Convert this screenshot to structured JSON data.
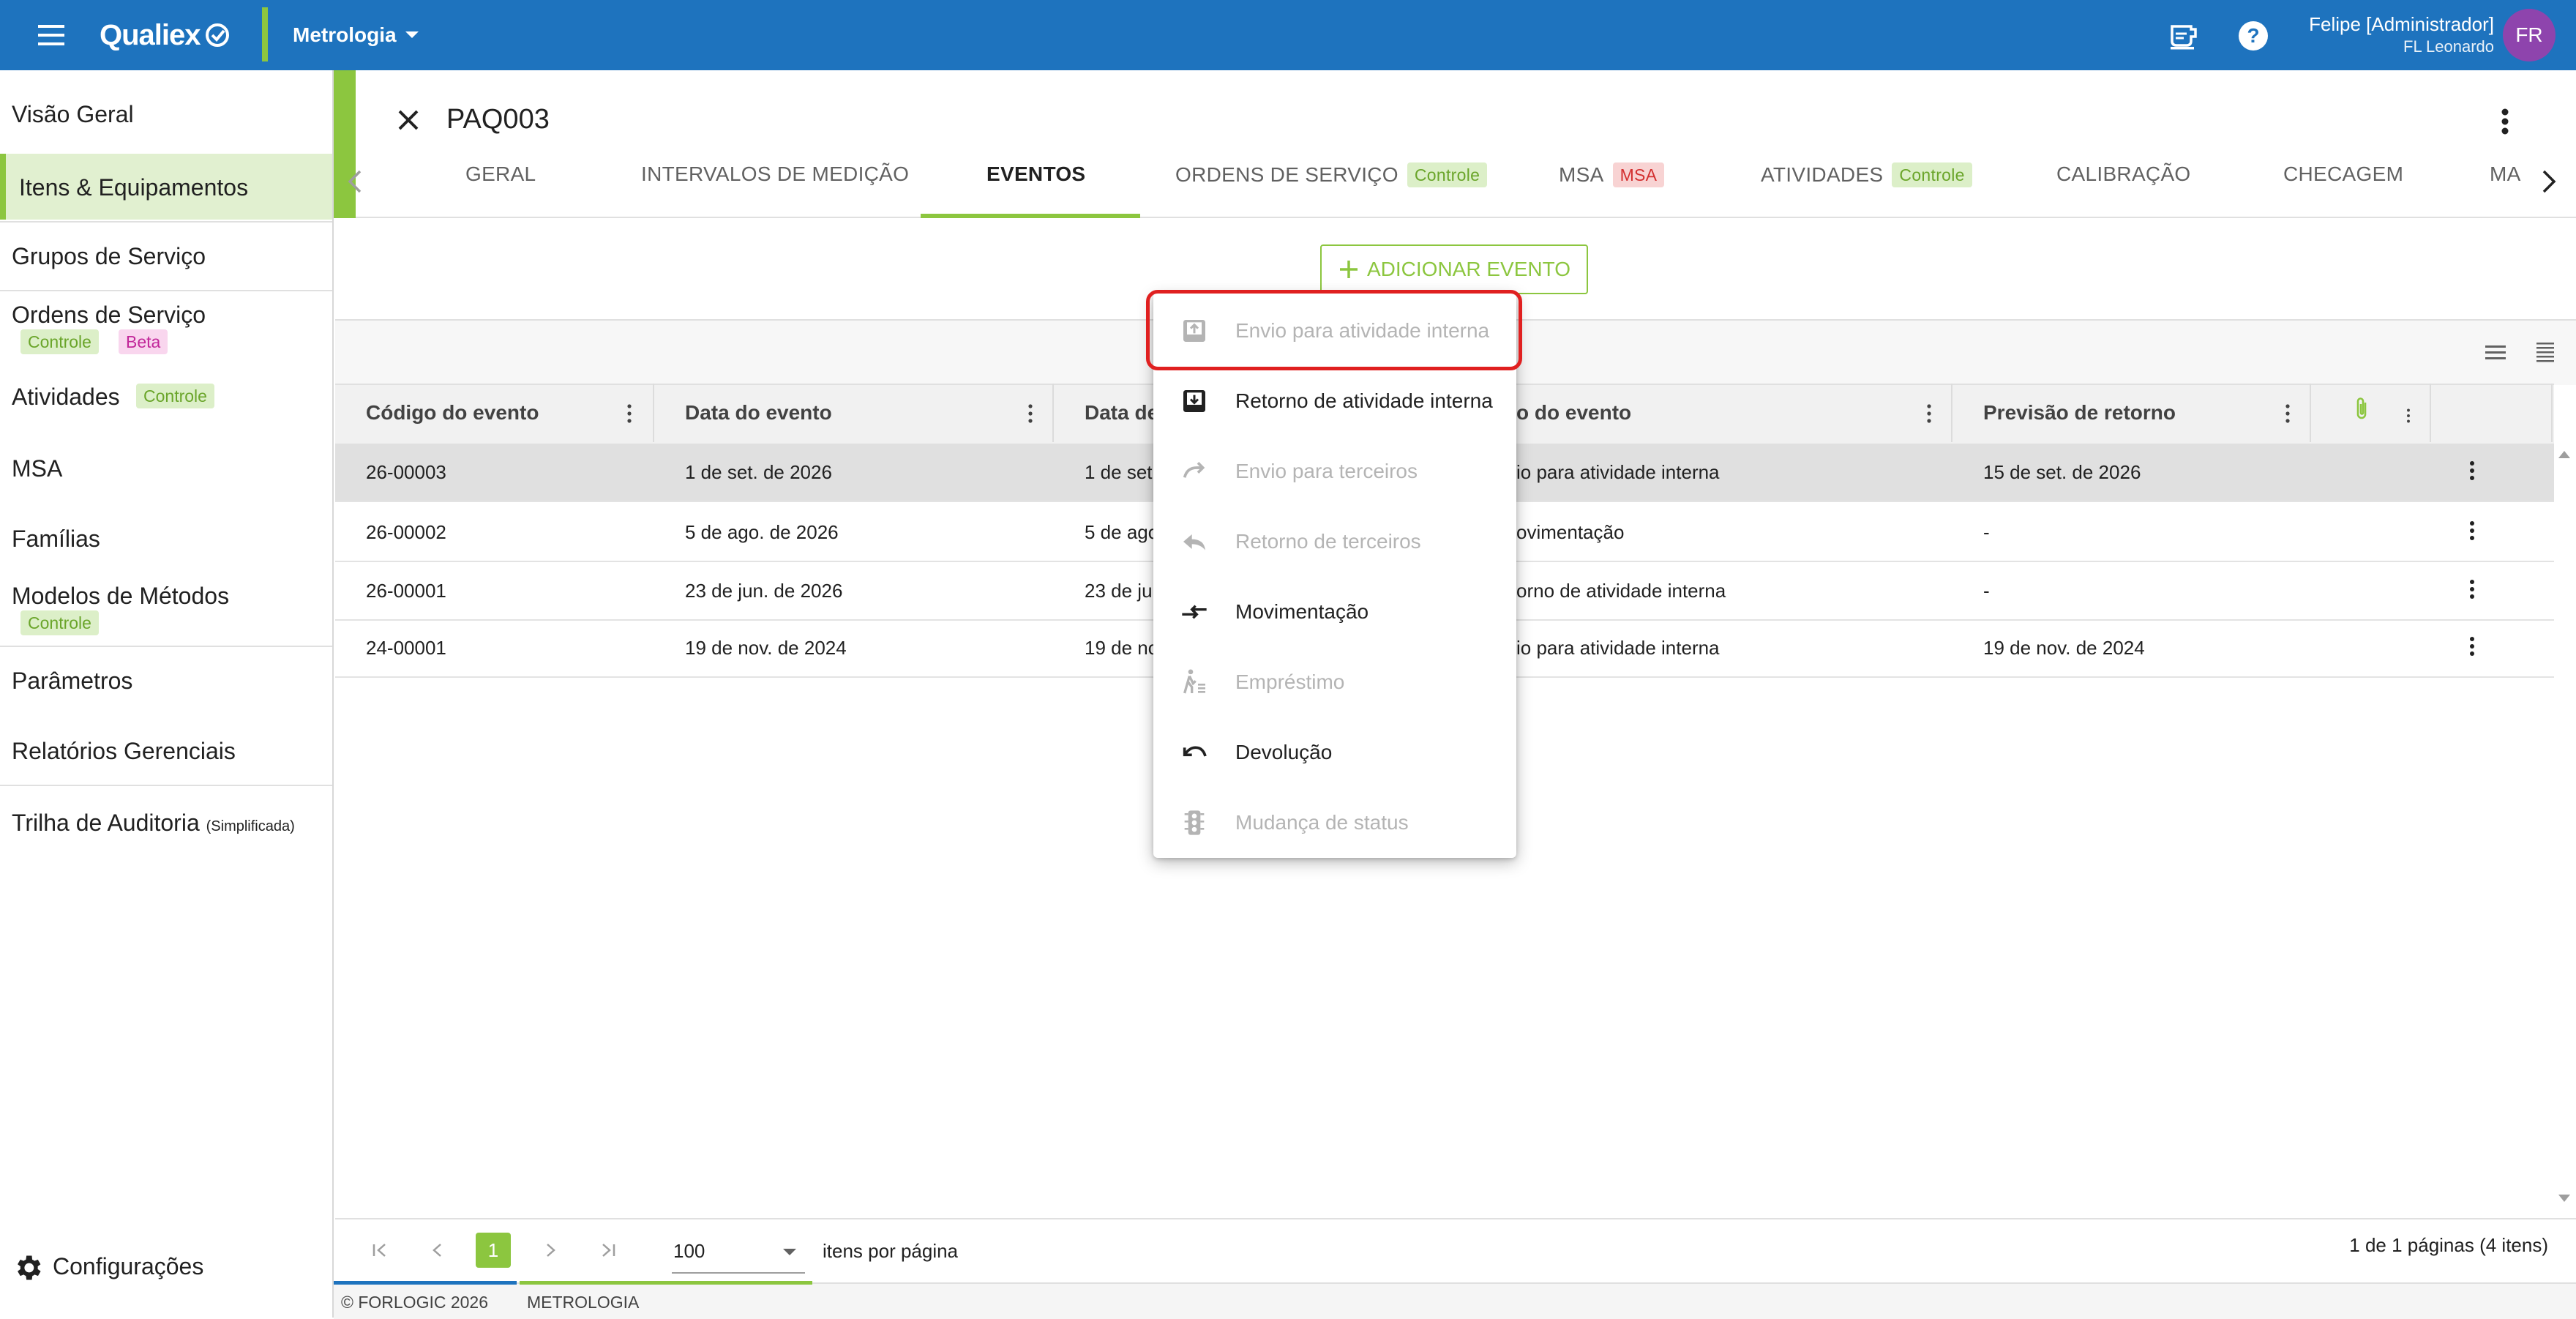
{
  "topbar": {
    "logo": "Qualiex",
    "module": "Metrologia",
    "user_name": "Felipe [Administrador]",
    "user_sub": "FL Leonardo",
    "avatar_initials": "FR",
    "icons": [
      "menu-icon",
      "qualiex-logo-icon",
      "chevron-down-icon",
      "cup-icon",
      "help-icon"
    ]
  },
  "sidebar": {
    "items": [
      {
        "label": "Visão Geral"
      },
      {
        "label": "Itens & Equipamentos",
        "active": true
      },
      {
        "label": "Grupos de Serviço"
      },
      {
        "label": "Ordens de Serviço",
        "chips": [
          "Controle",
          "Beta"
        ]
      },
      {
        "label": "Atividades",
        "chips": [
          "Controle"
        ]
      },
      {
        "label": "MSA"
      },
      {
        "label": "Famílias"
      },
      {
        "label": "Modelos de Métodos",
        "chips": [
          "Controle"
        ]
      },
      {
        "label": "Parâmetros"
      },
      {
        "label": "Relatórios Gerenciais"
      },
      {
        "label": "Trilha de Auditoria",
        "suffix": "(Simplificada)"
      }
    ],
    "settings_label": "Configurações"
  },
  "detail": {
    "title": "PAQ003",
    "tabs": [
      {
        "label": "GERAL"
      },
      {
        "label": "INTERVALOS DE MEDIÇÃO"
      },
      {
        "label": "EVENTOS",
        "active": true
      },
      {
        "label": "ORDENS DE SERVIÇO",
        "chip": "Controle"
      },
      {
        "label": "MSA",
        "chip": "MSA"
      },
      {
        "label": "ATIVIDADES",
        "chip": "Controle"
      },
      {
        "label": "CALIBRAÇÃO"
      },
      {
        "label": "CHECAGEM"
      },
      {
        "label": "MA"
      }
    ]
  },
  "add_event_label": "ADICIONAR EVENTO",
  "table": {
    "columns": [
      "Código do evento",
      "Data do evento",
      "Data de",
      "o do evento",
      "Previsão de retorno"
    ],
    "rows": [
      {
        "code": "26-00003",
        "date": "1 de set. de 2026",
        "date2": "1 de set",
        "type": "io para atividade interna",
        "return": "15 de set. de 2026",
        "selected": true
      },
      {
        "code": "26-00002",
        "date": "5 de ago. de 2026",
        "date2": "5 de ago",
        "type": "ovimentação",
        "return": "-"
      },
      {
        "code": "26-00001",
        "date": "23 de jun. de 2026",
        "date2": "23 de ju",
        "type": "orno de atividade interna",
        "return": "-"
      },
      {
        "code": "24-00001",
        "date": "19 de nov. de 2024",
        "date2": "19 de no",
        "type": "io para atividade interna",
        "return": "19 de nov. de 2024"
      }
    ]
  },
  "menu": {
    "items": [
      {
        "label": "Envio para atividade interna",
        "disabled": true,
        "icon": "inbox-upload-icon"
      },
      {
        "label": "Retorno de atividade interna",
        "disabled": false,
        "icon": "inbox-download-icon"
      },
      {
        "label": "Envio para terceiros",
        "disabled": true,
        "icon": "redo-arrow-icon"
      },
      {
        "label": "Retorno de terceiros",
        "disabled": true,
        "icon": "reply-arrow-icon"
      },
      {
        "label": "Movimentação",
        "disabled": false,
        "icon": "swap-arrows-icon"
      },
      {
        "label": "Empréstimo",
        "disabled": true,
        "icon": "walking-person-icon"
      },
      {
        "label": "Devolução",
        "disabled": false,
        "icon": "undo-arrow-icon"
      },
      {
        "label": "Mudança de status",
        "disabled": true,
        "icon": "traffic-light-icon"
      }
    ]
  },
  "pager": {
    "current_page": "1",
    "page_size": "100",
    "per_page_label": "itens por página",
    "summary": "1 de 1 páginas (4 itens)"
  },
  "footer": {
    "copyright": "© FORLOGIC 2026",
    "module": "METROLOGIA"
  },
  "colors": {
    "topbar": "#1e73be",
    "accent_green": "#8cc63f",
    "highlight_red": "#e02020",
    "avatar": "#8e44ad"
  }
}
